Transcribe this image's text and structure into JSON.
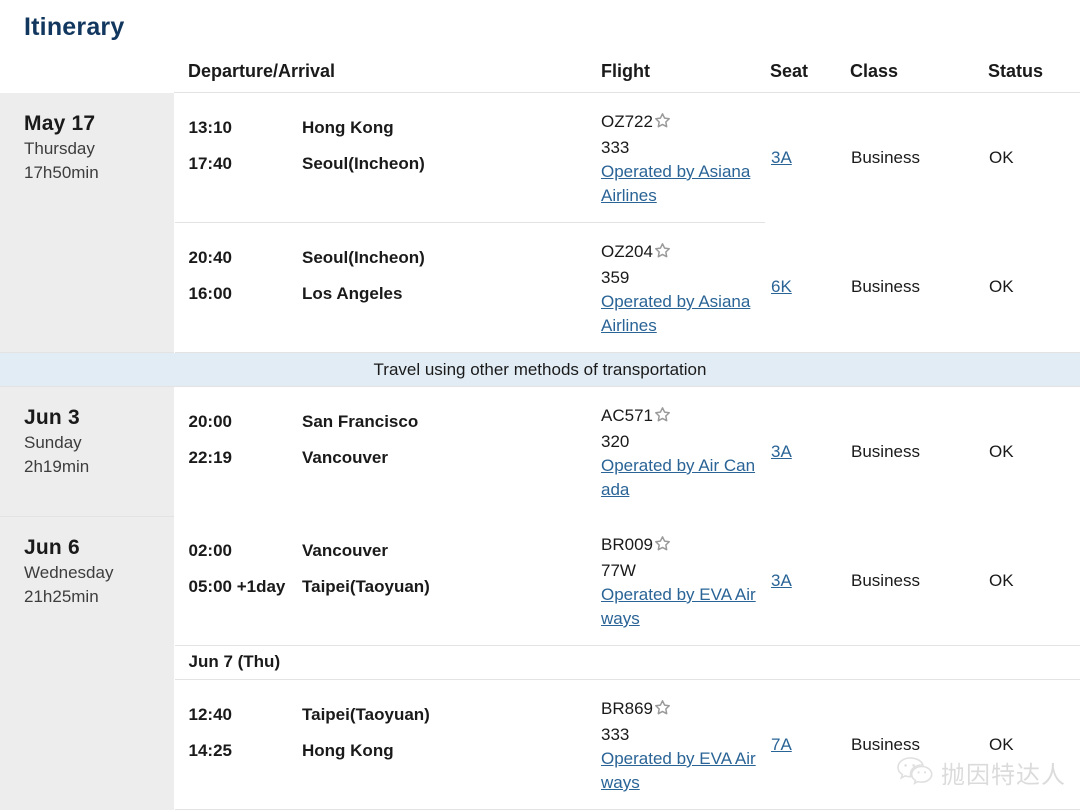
{
  "page_title": "Itinerary",
  "columns": {
    "date": "",
    "departure_arrival": "Departure/Arrival",
    "flight": "Flight",
    "seat": "Seat",
    "class": "Class",
    "status": "Status"
  },
  "banner": {
    "text": "Travel using other methods of transportation"
  },
  "colors": {
    "title": "#12375f",
    "link": "#2a6496",
    "date_column_bg": "#ededed",
    "banner_bg": "#e2ecf5",
    "rule": "#e3e3e3",
    "star": "#9a9a9a"
  },
  "icons": {
    "star": "star-icon",
    "wechat": "wechat-logo-icon"
  },
  "watermark": {
    "text": "抛因特达人"
  },
  "groups": [
    {
      "date": {
        "day": "May 17",
        "weekday": "Thursday",
        "duration": "17h50min"
      },
      "segments": [
        {
          "depart_time": "13:10",
          "depart_city": "Hong Kong",
          "arrive_time": "17:40",
          "arrive_plus": "",
          "arrive_city": "Seoul(Incheon)",
          "flight_number": "OZ722",
          "aircraft": "333",
          "operated_by": "Operated by Asiana Airlines",
          "seat": "3A",
          "cabin_class": "Business",
          "status": "OK"
        },
        {
          "depart_time": "20:40",
          "depart_city": "Seoul(Incheon)",
          "arrive_time": "16:00",
          "arrive_plus": "",
          "arrive_city": "Los Angeles",
          "flight_number": "OZ204",
          "aircraft": "359",
          "operated_by": "Operated by Asiana Airlines",
          "seat": "6K",
          "cabin_class": "Business",
          "status": "OK"
        }
      ]
    },
    {
      "date": {
        "day": "Jun 3",
        "weekday": "Sunday",
        "duration": "2h19min"
      },
      "segments": [
        {
          "depart_time": "20:00",
          "depart_city": "San Francisco",
          "arrive_time": "22:19",
          "arrive_plus": "",
          "arrive_city": "Vancouver",
          "flight_number": "AC571",
          "aircraft": "320",
          "operated_by": "Operated by Air Canada",
          "seat": "3A",
          "cabin_class": "Business",
          "status": "OK"
        }
      ]
    },
    {
      "date": {
        "day": "Jun 6",
        "weekday": "Wednesday",
        "duration": "21h25min"
      },
      "day_separator": "Jun 7 (Thu)",
      "segments": [
        {
          "depart_time": "02:00",
          "depart_city": "Vancouver",
          "arrive_time": "05:00",
          "arrive_plus": "+1day",
          "arrive_city": "Taipei(Taoyuan)",
          "flight_number": "BR009",
          "aircraft": "77W",
          "operated_by": "Operated by EVA Airways",
          "seat": "3A",
          "cabin_class": "Business",
          "status": "OK"
        },
        {
          "depart_time": "12:40",
          "depart_city": "Taipei(Taoyuan)",
          "arrive_time": "14:25",
          "arrive_plus": "",
          "arrive_city": "Hong Kong",
          "flight_number": "BR869",
          "aircraft": "333",
          "operated_by": "Operated by EVA Airways",
          "seat": "7A",
          "cabin_class": "Business",
          "status": "OK"
        }
      ]
    }
  ]
}
